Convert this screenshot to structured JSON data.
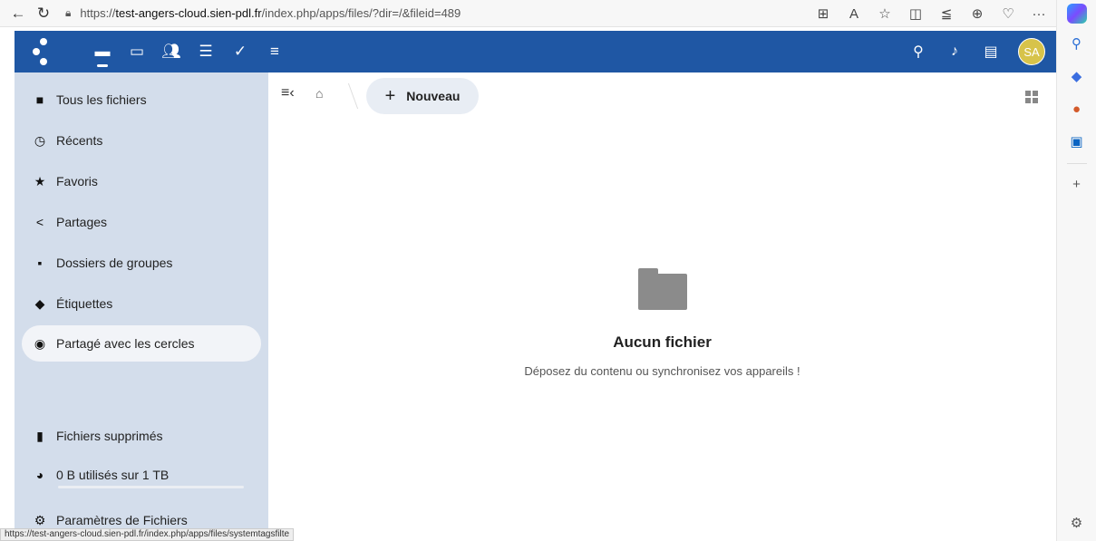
{
  "browser": {
    "url_prefix": "https://",
    "url_domain": "test-angers-cloud.sien-pdl.fr",
    "url_path": "/index.php/apps/files/?dir=/&fileid=489",
    "status_url": "https://test-angers-cloud.sien-pdl.fr/index.php/apps/files/systemtagsfilte"
  },
  "header": {
    "avatar_initials": "SA"
  },
  "sidebar": {
    "items": [
      {
        "label": "Tous les fichiers",
        "icon": "folder-icon"
      },
      {
        "label": "Récents",
        "icon": "clock-icon"
      },
      {
        "label": "Favoris",
        "icon": "star-icon"
      },
      {
        "label": "Partages",
        "icon": "share-icon"
      },
      {
        "label": "Dossiers de groupes",
        "icon": "group-folder-icon"
      },
      {
        "label": "Étiquettes",
        "icon": "tag-icon"
      },
      {
        "label": "Partagé avec les cercles",
        "icon": "circles-icon"
      }
    ],
    "trash_label": "Fichiers supprimés",
    "quota_label": "0 B utilisés sur 1 TB",
    "quota_fraction": 0.0,
    "settings_label": "Paramètres de Fichiers"
  },
  "main": {
    "new_label": "Nouveau",
    "empty_title": "Aucun fichier",
    "empty_desc": "Déposez du contenu ou synchronisez vos appareils !"
  },
  "colors": {
    "header_bg": "#1f57a4",
    "sidebar_bg": "#d3ddeb",
    "avatar_bg": "#d7c34a"
  }
}
